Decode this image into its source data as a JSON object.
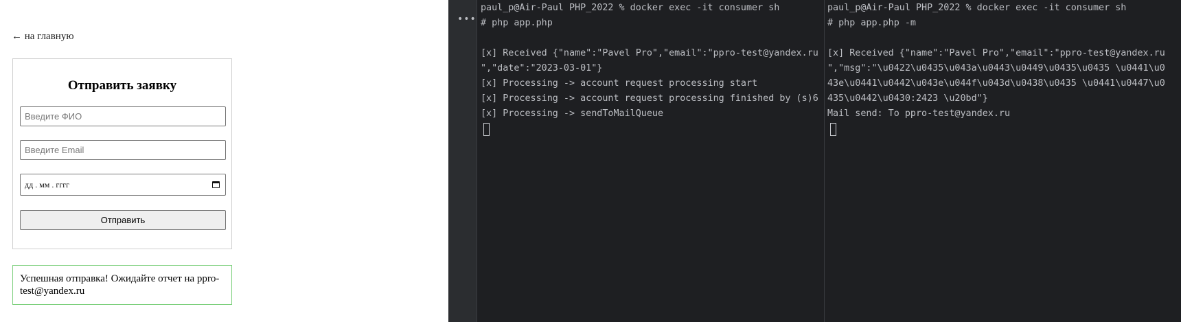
{
  "app": {
    "back_link": "← на главную",
    "form": {
      "title": "Отправить заявку",
      "name_placeholder": "Введите ФИО",
      "email_placeholder": "Введите Email",
      "date_value": "дд . мм . гггг",
      "submit_label": "Отправить"
    },
    "success_message": "Успешная отправка! Ожидайте отчет на ppro-test@yandex.ru"
  },
  "terminal": {
    "pane1": {
      "lines": [
        "paul_p@Air-Paul PHP_2022 % docker exec -it consumer sh",
        "# php app.php",
        "",
        "[x] Received {\"name\":\"Pavel Pro\",\"email\":\"ppro-test@yandex.ru",
        "\",\"date\":\"2023-03-01\"}",
        "[x] Processing -> account request processing start",
        "[x] Processing -> account request processing finished by (s)6",
        "[x] Processing -> sendToMailQueue"
      ]
    },
    "pane2": {
      "lines": [
        "paul_p@Air-Paul PHP_2022 % docker exec -it consumer sh",
        "# php app.php -m",
        "",
        "[x] Received {\"name\":\"Pavel Pro\",\"email\":\"ppro-test@yandex.ru",
        "\",\"msg\":\"\\u0422\\u0435\\u043a\\u0443\\u0449\\u0435\\u0435 \\u0441\\u0",
        "43e\\u0441\\u0442\\u043e\\u044f\\u043d\\u0438\\u0435 \\u0441\\u0447\\u0",
        "435\\u0442\\u0430:2423 \\u20bd\"}",
        "Mail send: To ppro-test@yandex.ru"
      ]
    }
  }
}
